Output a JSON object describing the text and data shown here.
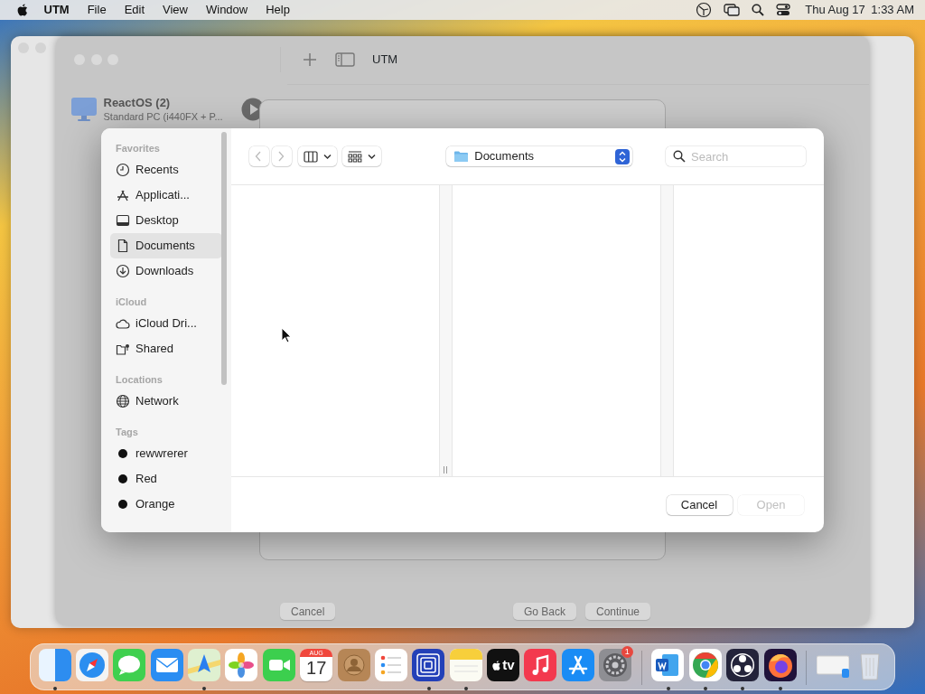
{
  "menu_bar": {
    "app": "UTM",
    "menus": [
      "File",
      "Edit",
      "View",
      "Window",
      "Help"
    ],
    "date": "Thu Aug 17",
    "time": "1:33 AM"
  },
  "utm_window": {
    "title": "UTM",
    "vm": {
      "name": "ReactOS (2)",
      "detail": "Standard PC (i440FX + P..."
    },
    "sheet_buttons": [
      {
        "label": "Cancel"
      },
      {
        "label": "Go Back"
      },
      {
        "label": "Continue"
      }
    ]
  },
  "open_dialog": {
    "sidebar": [
      {
        "heading": "Favorites",
        "items": [
          {
            "label": "Recents",
            "kind": "clock",
            "selected": false
          },
          {
            "label": "Applicati...",
            "kind": "apps",
            "selected": false
          },
          {
            "label": "Desktop",
            "kind": "desktop",
            "selected": false
          },
          {
            "label": "Documents",
            "kind": "document",
            "selected": true
          },
          {
            "label": "Downloads",
            "kind": "download",
            "selected": false
          }
        ]
      },
      {
        "heading": "iCloud",
        "items": [
          {
            "label": "iCloud Dri...",
            "kind": "cloud",
            "selected": false
          },
          {
            "label": "Shared",
            "kind": "shared",
            "selected": false
          }
        ]
      },
      {
        "heading": "Locations",
        "items": [
          {
            "label": "Network",
            "kind": "globe",
            "selected": false
          }
        ]
      },
      {
        "heading": "Tags",
        "items": [
          {
            "label": "rewwrerer",
            "kind": "tag",
            "selected": false
          },
          {
            "label": "Red",
            "kind": "tag",
            "selected": false
          },
          {
            "label": "Orange",
            "kind": "tag",
            "selected": false
          }
        ]
      }
    ],
    "location": "Documents",
    "search": {
      "placeholder": "Search"
    },
    "buttons": [
      {
        "label": "Cancel",
        "disabled": false
      },
      {
        "label": "Open",
        "disabled": true
      }
    ]
  },
  "dock": [
    {
      "kind": "finder",
      "running": true
    },
    {
      "kind": "safari",
      "running": false
    },
    {
      "kind": "messages",
      "running": false
    },
    {
      "kind": "mail",
      "running": false
    },
    {
      "kind": "maps",
      "running": true
    },
    {
      "kind": "photos",
      "running": false
    },
    {
      "kind": "facetime",
      "running": false
    },
    {
      "kind": "calendar",
      "running": false,
      "month": "AUG",
      "day": "17"
    },
    {
      "kind": "contacts",
      "running": false
    },
    {
      "kind": "reminders",
      "running": false
    },
    {
      "kind": "utm",
      "running": true
    },
    {
      "kind": "notes",
      "running": true
    },
    {
      "kind": "tv",
      "running": false,
      "label": "tv"
    },
    {
      "kind": "music",
      "running": false
    },
    {
      "kind": "appstore",
      "running": false
    },
    {
      "kind": "settings",
      "running": false,
      "badge": "1"
    },
    {
      "kind": "divider"
    },
    {
      "kind": "word",
      "running": true
    },
    {
      "kind": "chrome",
      "running": true
    },
    {
      "kind": "obs",
      "running": true
    },
    {
      "kind": "firefox",
      "running": true
    },
    {
      "kind": "divider"
    },
    {
      "kind": "preview",
      "running": false
    },
    {
      "kind": "trash",
      "running": false
    }
  ]
}
